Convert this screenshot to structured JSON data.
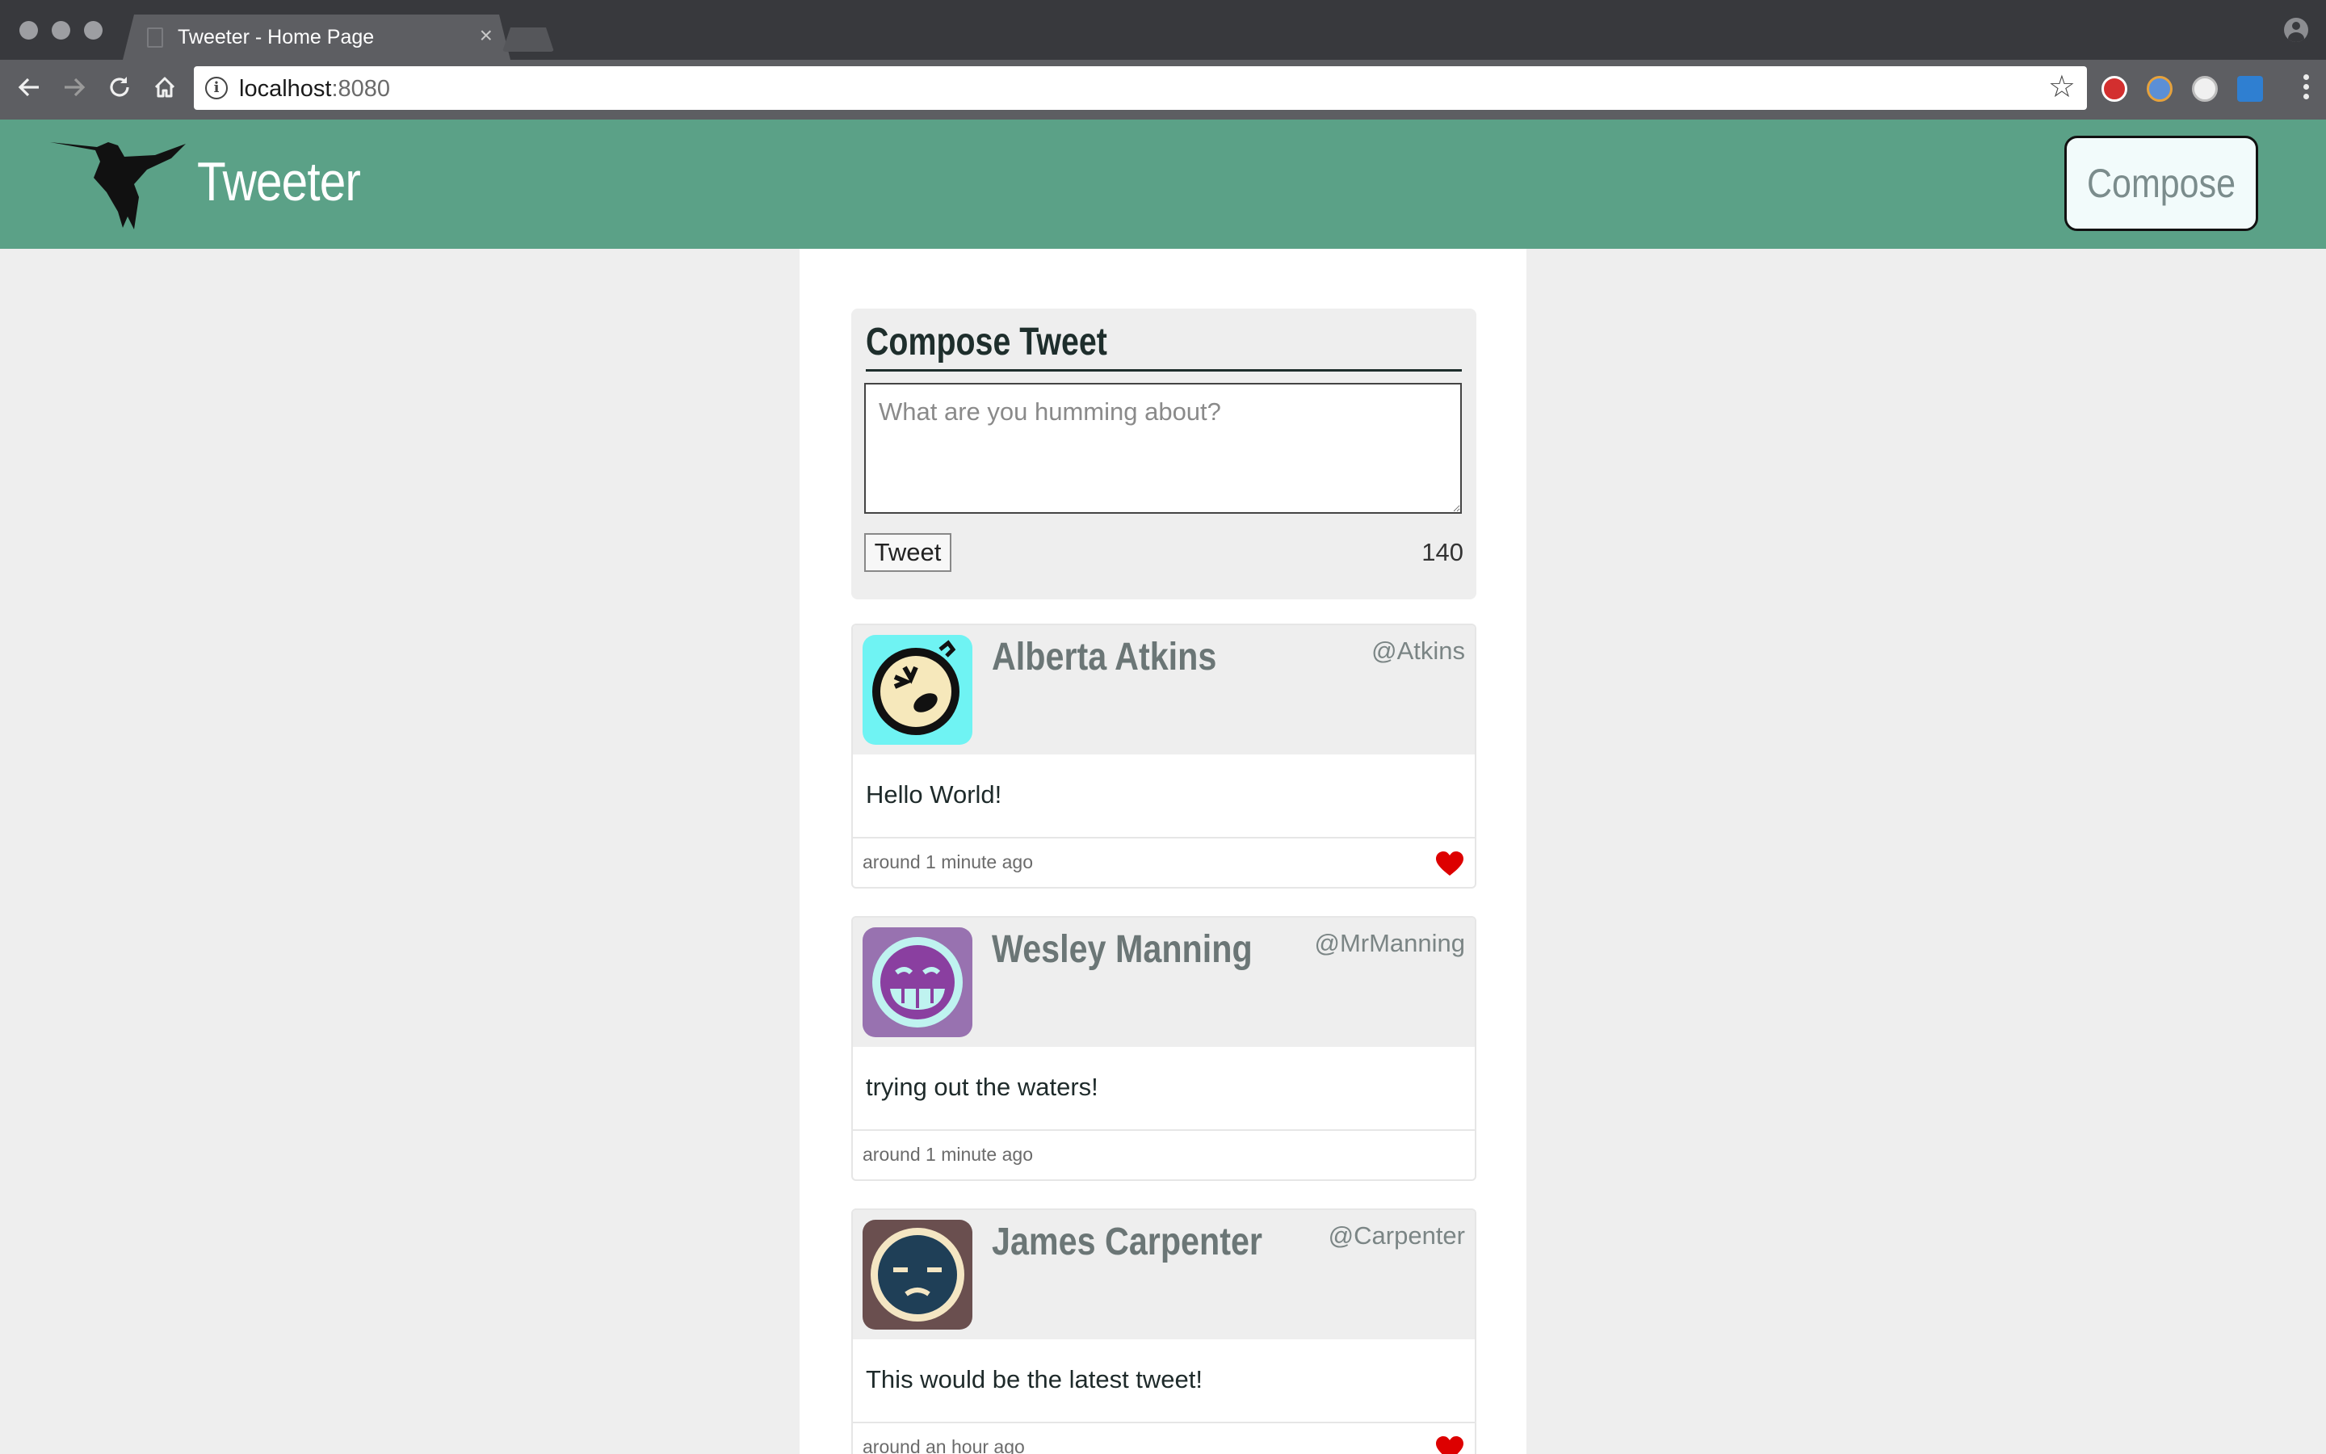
{
  "browser": {
    "tab_title": "Tweeter - Home Page",
    "tab_close": "×",
    "url_host": "localhost",
    "url_port": ":8080",
    "star": "☆"
  },
  "nav": {
    "brand": "Tweeter",
    "compose_label": "Compose"
  },
  "compose": {
    "heading": "Compose Tweet",
    "placeholder": "What are you humming about?",
    "submit_label": "Tweet",
    "counter": "140"
  },
  "tweets": [
    {
      "name": "Alberta Atkins",
      "handle": "@Atkins",
      "text": "Hello World!",
      "time": "around 1 minute ago",
      "liked": true
    },
    {
      "name": "Wesley Manning",
      "handle": "@MrManning",
      "text": "trying out the waters!",
      "time": "around 1 minute ago",
      "liked": false
    },
    {
      "name": "James Carpenter",
      "handle": "@Carpenter",
      "text": "This would be the latest tweet!",
      "time": "around an hour ago",
      "liked": true
    }
  ],
  "colors": {
    "nav_bg": "#5ba187",
    "heart": "#dd0000",
    "page_bg": "#eeeeee"
  }
}
